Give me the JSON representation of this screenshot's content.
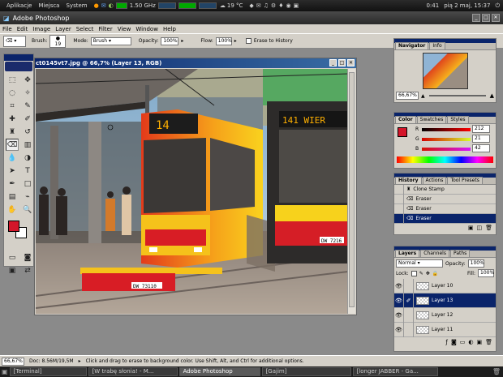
{
  "system_panel": {
    "menus": [
      "Aplikacje",
      "Miejsca",
      "System"
    ],
    "cpu": "1.50 GHz",
    "weather": "19 °C",
    "clock": "0:41",
    "date": "pią 2 maj, 15:37"
  },
  "app": {
    "title": "Adobe Photoshop"
  },
  "menu": [
    "File",
    "Edit",
    "Image",
    "Layer",
    "Select",
    "Filter",
    "View",
    "Window",
    "Help"
  ],
  "options": {
    "brush_label": "Brush:",
    "brush_size": "19",
    "mode_label": "Mode:",
    "mode_value": "Brush",
    "opacity_label": "Opacity:",
    "opacity_value": "100%",
    "flow_label": "Flow:",
    "flow_value": "100%",
    "erase_history": "Erase to History"
  },
  "document": {
    "title": "ct0145vt7.jpg @ 66,7% (Layer 13, RGB)"
  },
  "image_text": {
    "tram_number": "14",
    "tram2_sign": "141  WIER",
    "plate1": "DW 73110",
    "plate2": "DW 7216"
  },
  "navigator": {
    "tabs": [
      "Navigator",
      "Info"
    ],
    "zoom": "66,67%"
  },
  "color": {
    "tabs": [
      "Color",
      "Swatches",
      "Styles"
    ],
    "r_label": "R",
    "r_value": "212",
    "g_label": "G",
    "g_value": "21",
    "b_label": "B",
    "b_value": "42",
    "fg": "#d4152a"
  },
  "history": {
    "tabs": [
      "History",
      "Actions",
      "Tool Presets"
    ],
    "items": [
      "Clone Stamp",
      "Eraser",
      "Eraser",
      "Eraser"
    ]
  },
  "layers": {
    "tabs": [
      "Layers",
      "Channels",
      "Paths"
    ],
    "blend_mode": "Normal",
    "opacity_label": "Opacity:",
    "opacity_value": "100%",
    "lock_label": "Lock:",
    "fill_label": "Fill:",
    "fill_value": "100%",
    "items": [
      "Layer 10",
      "Layer 13",
      "Layer 12",
      "Layer 11"
    ]
  },
  "status": {
    "zoom": "66,67%",
    "doc": "Doc: 8.56M/19,5M",
    "hint": "Click and drag to erase to background color. Use Shift, Alt, and Ctrl for additional options."
  },
  "taskbar": [
    "[Terminal]",
    "[W trabę słonia! - M...",
    "Adobe Photoshop",
    "[Gajim]",
    "[longer JABBER - Ga..."
  ]
}
